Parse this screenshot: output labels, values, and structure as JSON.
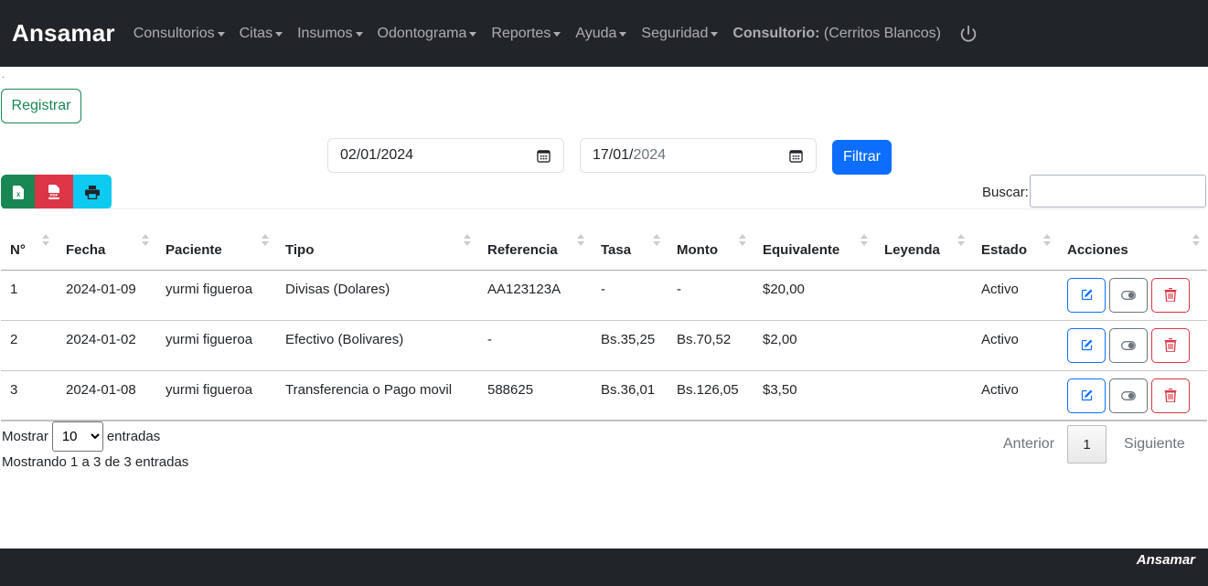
{
  "navbar": {
    "brand": "Ansamar",
    "menus": [
      {
        "label": "Consultorios"
      },
      {
        "label": "Citas"
      },
      {
        "label": "Insumos"
      },
      {
        "label": "Odontograma"
      },
      {
        "label": "Reportes"
      },
      {
        "label": "Ayuda"
      },
      {
        "label": "Seguridad"
      }
    ],
    "consultorio_label": "Consultorio:",
    "consultorio_value": "(Cerritos Blancos)",
    "logout_icon": "power-icon"
  },
  "stray_dot": ".",
  "toolbar": {
    "registrar_label": "Registrar",
    "date_from": {
      "day_month": "02/01/",
      "year": "2024"
    },
    "date_to": {
      "day_month": "17/01/",
      "year": "2024"
    },
    "filtrar_label": "Filtrar",
    "export_icons": [
      "excel-icon",
      "pdf-icon",
      "print-icon"
    ],
    "buscar_label": "Buscar:",
    "buscar_value": ""
  },
  "table": {
    "headers": [
      "N°",
      "Fecha",
      "Paciente",
      "Tipo",
      "Referencia",
      "Tasa",
      "Monto",
      "Equivalente",
      "Leyenda",
      "Estado",
      "Acciones"
    ],
    "rows": [
      {
        "n": "1",
        "fecha": "2024-01-09",
        "paciente": "yurmi figueroa",
        "tipo": "Divisas (Dolares)",
        "referencia": "AA123123A",
        "tasa": "-",
        "monto": "-",
        "equivalente": "$20,00",
        "leyenda": "",
        "estado": "Activo"
      },
      {
        "n": "2",
        "fecha": "2024-01-02",
        "paciente": "yurmi figueroa",
        "tipo": "Efectivo (Bolivares)",
        "referencia": "-",
        "tasa": "Bs.35,25",
        "monto": "Bs.70,52",
        "equivalente": "$2,00",
        "leyenda": "",
        "estado": "Activo"
      },
      {
        "n": "3",
        "fecha": "2024-01-08",
        "paciente": "yurmi figueroa",
        "tipo": "Transferencia o Pago movil",
        "referencia": "588625",
        "tasa": "Bs.36,01",
        "monto": "Bs.126,05",
        "equivalente": "$3,50",
        "leyenda": "",
        "estado": "Activo"
      }
    ],
    "action_icons": [
      "edit-icon",
      "toggle-icon",
      "trash-icon"
    ]
  },
  "datatable": {
    "mostrar_label": "Mostrar",
    "page_length": "10",
    "entradas_label": "entradas",
    "info": "Mostrando 1 a 3 de 3 entradas",
    "prev_label": "Anterior",
    "current_page": "1",
    "next_label": "Siguiente"
  },
  "footer": {
    "brand": "Ansamar"
  },
  "colors": {
    "navbar": "#212529",
    "success": "#198754",
    "primary": "#0d6efd",
    "danger": "#dc3545",
    "info": "#0dcaf0"
  }
}
